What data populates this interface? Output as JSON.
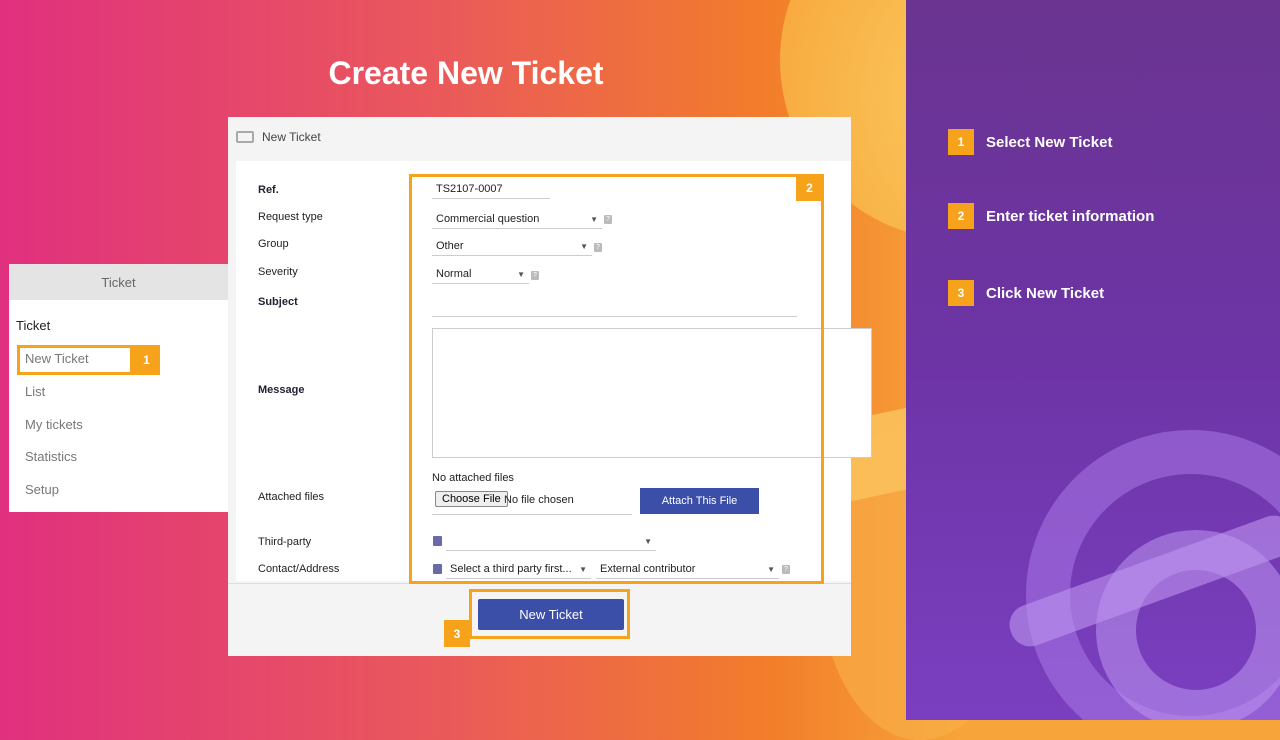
{
  "title": "Create New Ticket",
  "steps": [
    {
      "num": "1",
      "label": "Select New Ticket"
    },
    {
      "num": "2",
      "label": "Enter ticket information"
    },
    {
      "num": "3",
      "label": "Click New Ticket"
    }
  ],
  "sidebar": {
    "header": "Ticket",
    "section": "Ticket",
    "items": [
      "New Ticket",
      "List",
      "My tickets",
      "Statistics",
      "Setup"
    ]
  },
  "window": {
    "title": "New Ticket"
  },
  "form": {
    "ref_label": "Ref.",
    "ref_value": "TS2107-0007",
    "request_type_label": "Request type",
    "request_type_value": "Commercial question",
    "group_label": "Group",
    "group_value": "Other",
    "severity_label": "Severity",
    "severity_value": "Normal",
    "subject_label": "Subject",
    "subject_value": "",
    "message_label": "Message",
    "attached_label": "Attached files",
    "no_attached": "No attached files",
    "choose_file": "Choose File",
    "no_file_chosen": "No file chosen",
    "attach_button": "Attach This File",
    "third_party_label": "Third-party",
    "third_party_value": "",
    "contact_label": "Contact/Address",
    "contact_value": "Select a third party first...",
    "contributor_value": "External contributor",
    "submit_button": "New Ticket"
  },
  "colors": {
    "accent": "#f7a21b",
    "button": "#3b4fa8",
    "panel": "#6d34a6"
  }
}
